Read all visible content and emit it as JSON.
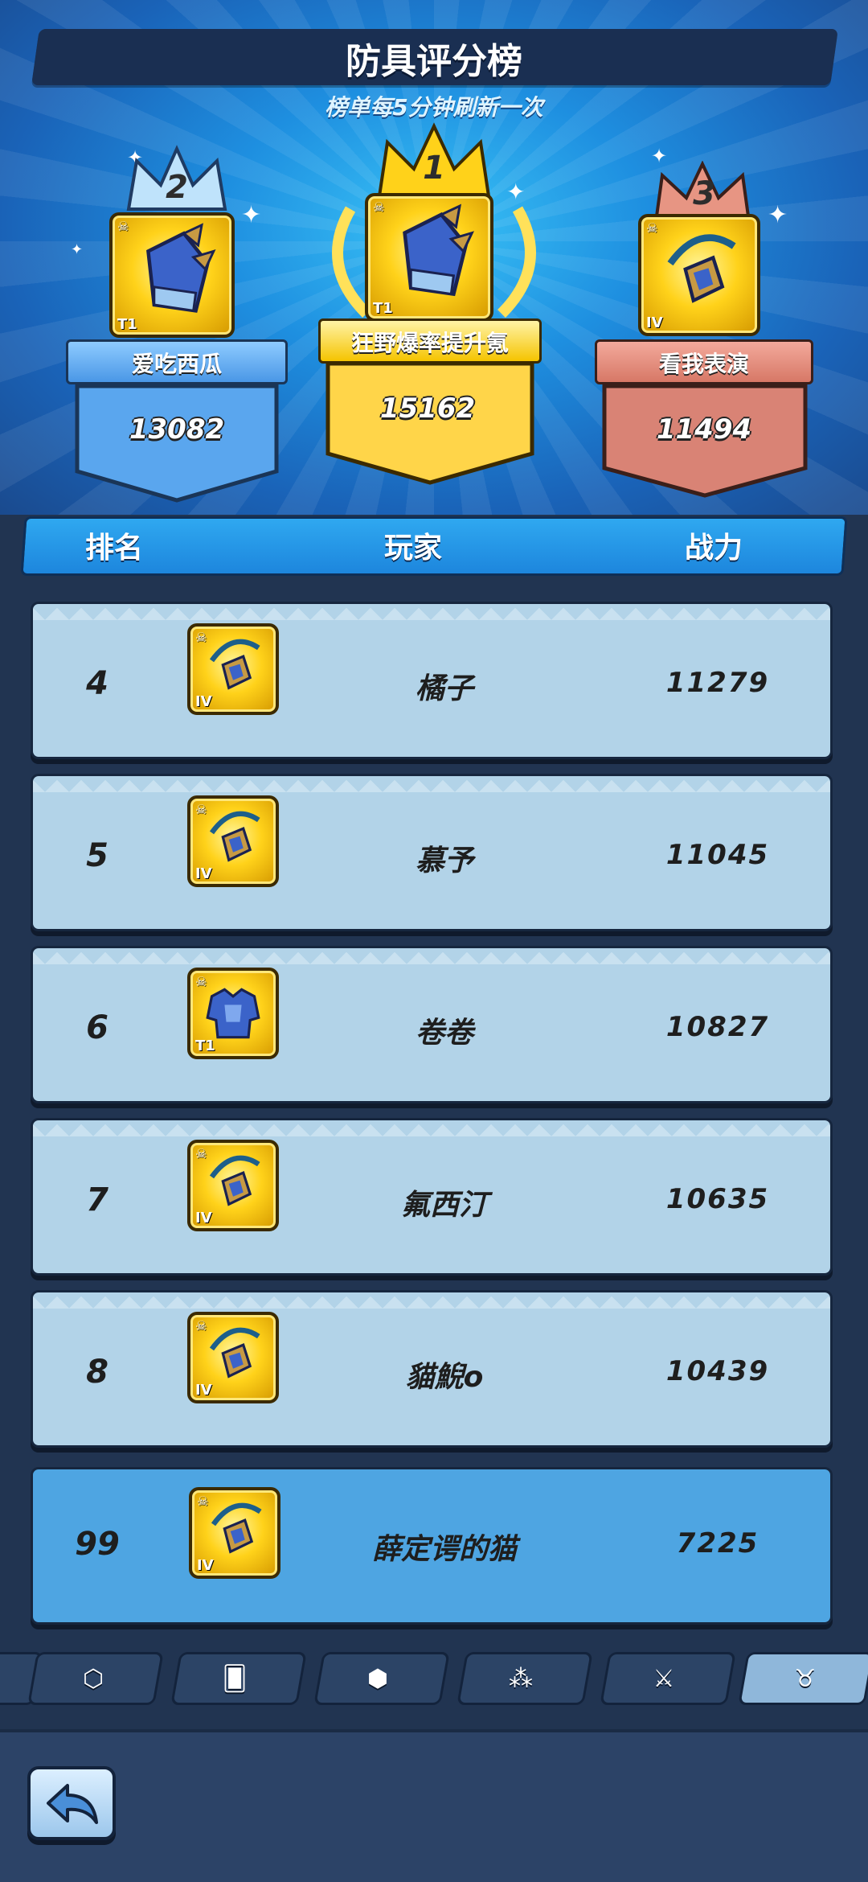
{
  "header": {
    "title": "防具评分榜",
    "subtitle": "榜单每5分钟刷新一次"
  },
  "podium": {
    "first": {
      "rank": "1",
      "name": "狂野爆率提升氪",
      "score": "15162",
      "tier": "T1",
      "item_icon": "gauntlet-icon"
    },
    "second": {
      "rank": "2",
      "name": "爱吃西瓜",
      "score": "13082",
      "tier": "T1",
      "item_icon": "gauntlet-icon"
    },
    "third": {
      "rank": "3",
      "name": "看我表演",
      "score": "11494",
      "tier": "IV",
      "item_icon": "amulet-icon"
    }
  },
  "table": {
    "headers": {
      "rank": "排名",
      "player": "玩家",
      "power": "战力"
    },
    "rows": [
      {
        "rank": "4",
        "name": "橘子",
        "power": "11279",
        "tier": "IV",
        "item_icon": "amulet-icon"
      },
      {
        "rank": "5",
        "name": "慕予",
        "power": "11045",
        "tier": "IV",
        "item_icon": "amulet-icon"
      },
      {
        "rank": "6",
        "name": "卷卷",
        "power": "10827",
        "tier": "T1",
        "item_icon": "chest-armor-icon"
      },
      {
        "rank": "7",
        "name": "氟西汀",
        "power": "10635",
        "tier": "IV",
        "item_icon": "amulet-icon"
      },
      {
        "rank": "8",
        "name": "貓鯢o",
        "power": "10439",
        "tier": "IV",
        "item_icon": "amulet-icon"
      }
    ],
    "my_row": {
      "rank": "99",
      "name": "薛定谔的猫",
      "power": "7225",
      "tier": "IV",
      "item_icon": "amulet-icon"
    }
  },
  "tabs": [
    {
      "icon": "partial-tab-icon",
      "active": false
    },
    {
      "icon": "shield-badge-icon",
      "active": false
    },
    {
      "icon": "cards-icon",
      "active": false
    },
    {
      "icon": "gem-badge-icon",
      "active": false
    },
    {
      "icon": "skill-tree-icon",
      "active": false
    },
    {
      "icon": "sword-icon",
      "active": false
    },
    {
      "icon": "horned-helmet-icon",
      "active": true
    }
  ],
  "colors": {
    "gold": "#ffd21a",
    "silver_blue": "#5aa6ee",
    "bronze": "#d98375",
    "row_bg": "#b2d3e8",
    "my_row_bg": "#4ea5e2"
  }
}
